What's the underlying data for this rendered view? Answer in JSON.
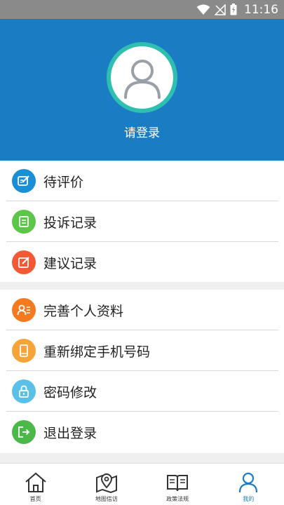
{
  "status_bar": {
    "time": "11:16"
  },
  "profile": {
    "login_label": "请登录"
  },
  "menu_group_1": [
    {
      "label": "待评价",
      "icon": "edit-icon",
      "color": "#1b8fd6"
    },
    {
      "label": "投诉记录",
      "icon": "list-icon",
      "color": "#5cc64a"
    },
    {
      "label": "建议记录",
      "icon": "pen-icon",
      "color": "#f25a36"
    }
  ],
  "menu_group_2": [
    {
      "label": "完善个人资料",
      "icon": "profile-icon",
      "color": "#f57a1f"
    },
    {
      "label": "重新绑定手机号码",
      "icon": "phone-icon",
      "color": "#f5a43a"
    },
    {
      "label": "密码修改",
      "icon": "lock-icon",
      "color": "#5bc0e8"
    },
    {
      "label": "退出登录",
      "icon": "logout-icon",
      "color": "#4db84a"
    }
  ],
  "tabs": [
    {
      "label": "首页",
      "icon": "home-icon"
    },
    {
      "label": "地图信访",
      "icon": "map-icon"
    },
    {
      "label": "政策法规",
      "icon": "book-icon"
    },
    {
      "label": "我的",
      "icon": "user-icon",
      "active": true
    }
  ],
  "colors": {
    "primary": "#1a7dc4",
    "avatar_ring": "#2fbfb0"
  }
}
